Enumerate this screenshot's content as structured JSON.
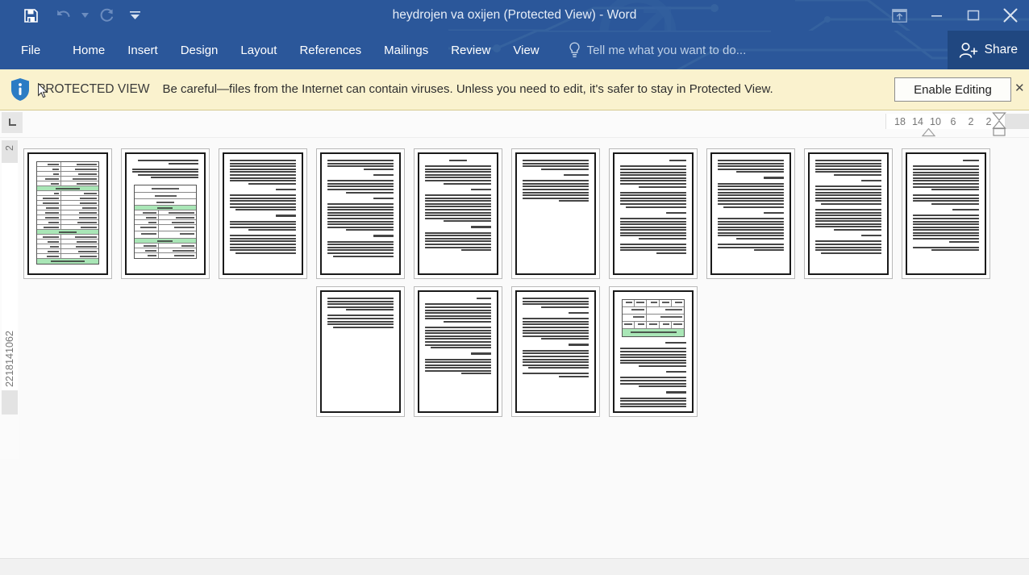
{
  "window": {
    "title": "heydrojen va oxijen (Protected View) - Word",
    "controls": {
      "ribbon_display_options": "ribbon-display-options",
      "minimize": "minimize",
      "maximize": "maximize",
      "close": "close"
    }
  },
  "quick_access": {
    "save": "Save",
    "undo": "Undo",
    "undo_dropdown": "Undo options",
    "redo": "Redo",
    "customize": "Customize Quick Access Toolbar"
  },
  "ribbon": {
    "tabs": [
      {
        "label": "File",
        "active": false
      },
      {
        "label": "Home",
        "active": false
      },
      {
        "label": "Insert",
        "active": false
      },
      {
        "label": "Design",
        "active": false
      },
      {
        "label": "Layout",
        "active": false
      },
      {
        "label": "References",
        "active": false
      },
      {
        "label": "Mailings",
        "active": false
      },
      {
        "label": "Review",
        "active": false
      },
      {
        "label": "View",
        "active": false
      }
    ],
    "tell_me_placeholder": "Tell me what you want to do...",
    "share_label": "Share"
  },
  "protected_view": {
    "badge": "PROTECTED VIEW",
    "message": "Be careful—files from the Internet can contain viruses. Unless you need to edit, it's safer to stay in Protected View.",
    "enable_button": "Enable Editing",
    "close": "✕",
    "bar_color": "#faf2ce"
  },
  "ruler": {
    "tab_selector": "L",
    "horizontal_marks": [
      "18",
      "14",
      "10",
      "6",
      "2",
      "2"
    ],
    "vertical_top_mark": "2",
    "vertical_marks": [
      "2",
      "6",
      "10",
      "14",
      "18",
      "22"
    ]
  },
  "theme": {
    "accent": "#2b579a",
    "share_bg": "#204780",
    "canvas_bg": "#fafafa",
    "highlight_green": "#a9e6b6",
    "warning_bg": "#faf2ce"
  },
  "document": {
    "view_mode": "Multiple Pages",
    "page_count": 14,
    "rows": [
      {
        "pages": [
          {
            "number": 1,
            "kind": "table"
          },
          {
            "number": 2,
            "kind": "text-table"
          },
          {
            "number": 3,
            "kind": "text"
          },
          {
            "number": 4,
            "kind": "text"
          },
          {
            "number": 5,
            "kind": "text"
          },
          {
            "number": 6,
            "kind": "text-short"
          },
          {
            "number": 7,
            "kind": "text"
          },
          {
            "number": 8,
            "kind": "text"
          },
          {
            "number": 9,
            "kind": "text"
          },
          {
            "number": 10,
            "kind": "text"
          }
        ]
      },
      {
        "pages": [
          {
            "number": 11,
            "kind": "text-short"
          },
          {
            "number": 12,
            "kind": "text"
          },
          {
            "number": 13,
            "kind": "text"
          },
          {
            "number": 14,
            "kind": "table-text"
          }
        ]
      }
    ]
  }
}
